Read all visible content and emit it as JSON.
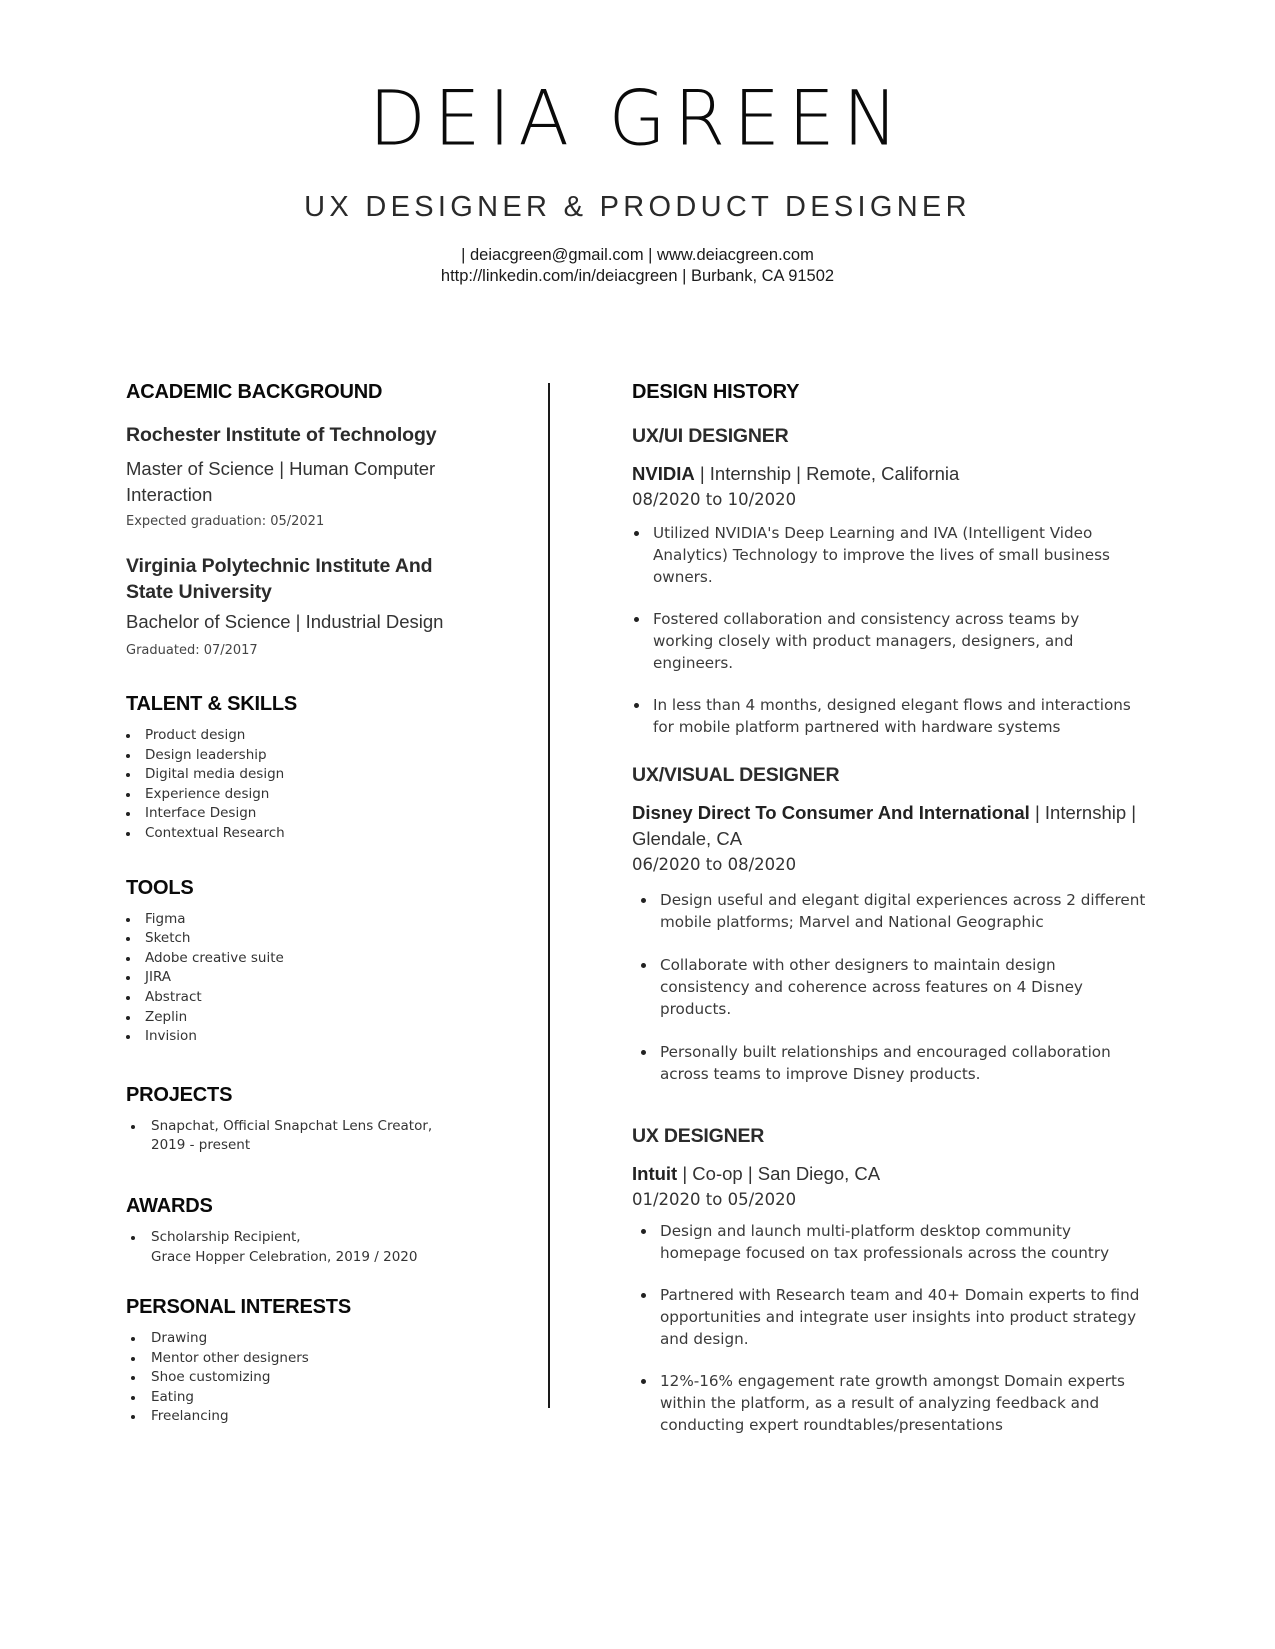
{
  "header": {
    "name": "DEIA GREEN",
    "title": "UX DESIGNER & PRODUCT DESIGNER",
    "contact_line1": "|  deiacgreen@gmail.com  |   www.deiacgreen.com",
    "contact_line2": "http://linkedin.com/in/deiacgreen  | Burbank, CA 91502",
    "email": "deiacgreen@gmail.com",
    "website": "www.deiacgreen.com",
    "linkedin": "http://linkedin.com/in/deiacgreen",
    "location": "Burbank, CA 91502"
  },
  "left": {
    "academic": {
      "heading": "ACADEMIC BACKGROUND",
      "schools": [
        {
          "name": "Rochester Institute of Technology",
          "degree": "Master of Science | Human Computer Interaction",
          "grad": "Expected graduation: 05/2021"
        },
        {
          "name": "Virginia Polytechnic Institute And State University",
          "degree": "Bachelor of Science | Industrial Design",
          "grad": "Graduated: 07/2017"
        }
      ]
    },
    "skills": {
      "heading": "TALENT & SKILLS",
      "items": [
        "Product design",
        "Design leadership",
        "Digital media design",
        "Experience design",
        "Interface Design",
        "Contextual Research"
      ]
    },
    "tools": {
      "heading": "TOOLS",
      "items": [
        "Figma",
        "Sketch",
        "Adobe creative suite",
        "JIRA",
        "Abstract",
        "Zeplin",
        "Invision"
      ]
    },
    "projects": {
      "heading": "PROJECTS",
      "items": [
        "Snapchat, Official Snapchat Lens Creator, 2019 - present"
      ]
    },
    "awards": {
      "heading": "AWARDS",
      "items": [
        "Scholarship Recipient,",
        "Grace Hopper Celebration, 2019 / 2020"
      ]
    },
    "interests": {
      "heading": "PERSONAL INTERESTS",
      "items": [
        "Drawing",
        "Mentor other designers",
        "Shoe customizing",
        "Eating",
        "Freelancing"
      ]
    }
  },
  "right": {
    "heading": "DESIGN HISTORY",
    "jobs": [
      {
        "role": "UX/UI DESIGNER",
        "company": "NVIDIA",
        "details": " | Internship | Remote, California",
        "dates": "08/2020 to 10/2020",
        "bullets": [
          "Utilized NVIDIA's Deep Learning and IVA (Intelligent Video Analytics) Technology to improve the lives of small business owners.",
          "Fostered collaboration and consistency across teams by working closely with product managers, designers, and engineers.",
          "In less than 4 months, designed elegant flows and interactions for mobile platform partnered with hardware systems"
        ]
      },
      {
        "role": "UX/VISUAL DESIGNER",
        "company": "Disney Direct To Consumer And International",
        "details": " | Internship | Glendale, CA",
        "dates": "06/2020 to 08/2020",
        "bullets": [
          "Design useful and elegant digital experiences across 2 different mobile platforms; Marvel and National Geographic",
          "Collaborate with other designers to maintain design consistency and coherence across features on 4 Disney products.",
          "Personally built relationships and encouraged collaboration across teams to improve Disney products."
        ]
      },
      {
        "role": "UX DESIGNER",
        "company": "Intuit",
        "details": " | Co-op | San Diego, CA",
        "dates": "01/2020 to 05/2020",
        "bullets": [
          "Design and launch multi-platform desktop community homepage focused on tax professionals across the country",
          "Partnered with Research team and 40+ Domain experts to find opportunities and integrate user insights into product strategy and design.",
          "12%-16% engagement rate growth amongst Domain experts within the platform, as a result of analyzing feedback and conducting expert roundtables/presentations"
        ]
      }
    ]
  }
}
